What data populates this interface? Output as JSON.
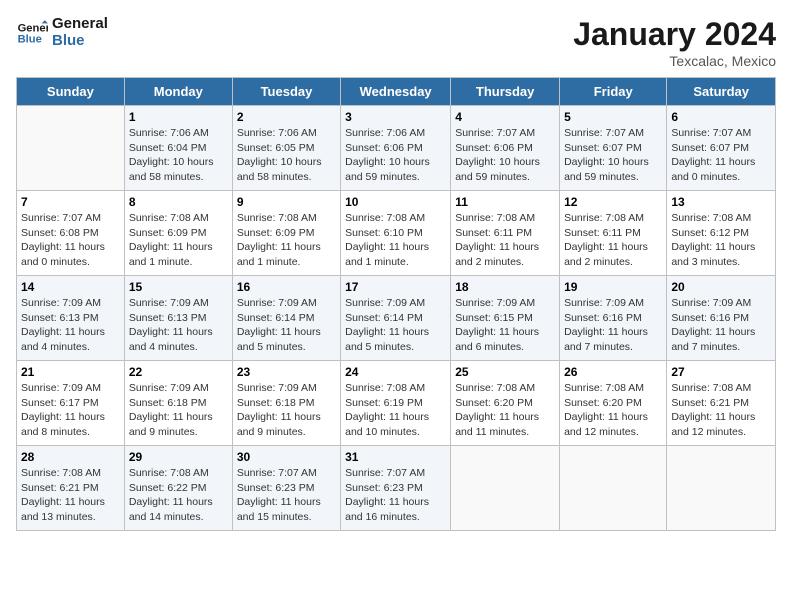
{
  "header": {
    "logo_general": "General",
    "logo_blue": "Blue",
    "title": "January 2024",
    "subtitle": "Texcalac, Mexico"
  },
  "weekdays": [
    "Sunday",
    "Monday",
    "Tuesday",
    "Wednesday",
    "Thursday",
    "Friday",
    "Saturday"
  ],
  "weeks": [
    [
      {
        "num": "",
        "info": ""
      },
      {
        "num": "1",
        "info": "Sunrise: 7:06 AM\nSunset: 6:04 PM\nDaylight: 10 hours\nand 58 minutes."
      },
      {
        "num": "2",
        "info": "Sunrise: 7:06 AM\nSunset: 6:05 PM\nDaylight: 10 hours\nand 58 minutes."
      },
      {
        "num": "3",
        "info": "Sunrise: 7:06 AM\nSunset: 6:06 PM\nDaylight: 10 hours\nand 59 minutes."
      },
      {
        "num": "4",
        "info": "Sunrise: 7:07 AM\nSunset: 6:06 PM\nDaylight: 10 hours\nand 59 minutes."
      },
      {
        "num": "5",
        "info": "Sunrise: 7:07 AM\nSunset: 6:07 PM\nDaylight: 10 hours\nand 59 minutes."
      },
      {
        "num": "6",
        "info": "Sunrise: 7:07 AM\nSunset: 6:07 PM\nDaylight: 11 hours\nand 0 minutes."
      }
    ],
    [
      {
        "num": "7",
        "info": "Sunrise: 7:07 AM\nSunset: 6:08 PM\nDaylight: 11 hours\nand 0 minutes."
      },
      {
        "num": "8",
        "info": "Sunrise: 7:08 AM\nSunset: 6:09 PM\nDaylight: 11 hours\nand 1 minute."
      },
      {
        "num": "9",
        "info": "Sunrise: 7:08 AM\nSunset: 6:09 PM\nDaylight: 11 hours\nand 1 minute."
      },
      {
        "num": "10",
        "info": "Sunrise: 7:08 AM\nSunset: 6:10 PM\nDaylight: 11 hours\nand 1 minute."
      },
      {
        "num": "11",
        "info": "Sunrise: 7:08 AM\nSunset: 6:11 PM\nDaylight: 11 hours\nand 2 minutes."
      },
      {
        "num": "12",
        "info": "Sunrise: 7:08 AM\nSunset: 6:11 PM\nDaylight: 11 hours\nand 2 minutes."
      },
      {
        "num": "13",
        "info": "Sunrise: 7:08 AM\nSunset: 6:12 PM\nDaylight: 11 hours\nand 3 minutes."
      }
    ],
    [
      {
        "num": "14",
        "info": "Sunrise: 7:09 AM\nSunset: 6:13 PM\nDaylight: 11 hours\nand 4 minutes."
      },
      {
        "num": "15",
        "info": "Sunrise: 7:09 AM\nSunset: 6:13 PM\nDaylight: 11 hours\nand 4 minutes."
      },
      {
        "num": "16",
        "info": "Sunrise: 7:09 AM\nSunset: 6:14 PM\nDaylight: 11 hours\nand 5 minutes."
      },
      {
        "num": "17",
        "info": "Sunrise: 7:09 AM\nSunset: 6:14 PM\nDaylight: 11 hours\nand 5 minutes."
      },
      {
        "num": "18",
        "info": "Sunrise: 7:09 AM\nSunset: 6:15 PM\nDaylight: 11 hours\nand 6 minutes."
      },
      {
        "num": "19",
        "info": "Sunrise: 7:09 AM\nSunset: 6:16 PM\nDaylight: 11 hours\nand 7 minutes."
      },
      {
        "num": "20",
        "info": "Sunrise: 7:09 AM\nSunset: 6:16 PM\nDaylight: 11 hours\nand 7 minutes."
      }
    ],
    [
      {
        "num": "21",
        "info": "Sunrise: 7:09 AM\nSunset: 6:17 PM\nDaylight: 11 hours\nand 8 minutes."
      },
      {
        "num": "22",
        "info": "Sunrise: 7:09 AM\nSunset: 6:18 PM\nDaylight: 11 hours\nand 9 minutes."
      },
      {
        "num": "23",
        "info": "Sunrise: 7:09 AM\nSunset: 6:18 PM\nDaylight: 11 hours\nand 9 minutes."
      },
      {
        "num": "24",
        "info": "Sunrise: 7:08 AM\nSunset: 6:19 PM\nDaylight: 11 hours\nand 10 minutes."
      },
      {
        "num": "25",
        "info": "Sunrise: 7:08 AM\nSunset: 6:20 PM\nDaylight: 11 hours\nand 11 minutes."
      },
      {
        "num": "26",
        "info": "Sunrise: 7:08 AM\nSunset: 6:20 PM\nDaylight: 11 hours\nand 12 minutes."
      },
      {
        "num": "27",
        "info": "Sunrise: 7:08 AM\nSunset: 6:21 PM\nDaylight: 11 hours\nand 12 minutes."
      }
    ],
    [
      {
        "num": "28",
        "info": "Sunrise: 7:08 AM\nSunset: 6:21 PM\nDaylight: 11 hours\nand 13 minutes."
      },
      {
        "num": "29",
        "info": "Sunrise: 7:08 AM\nSunset: 6:22 PM\nDaylight: 11 hours\nand 14 minutes."
      },
      {
        "num": "30",
        "info": "Sunrise: 7:07 AM\nSunset: 6:23 PM\nDaylight: 11 hours\nand 15 minutes."
      },
      {
        "num": "31",
        "info": "Sunrise: 7:07 AM\nSunset: 6:23 PM\nDaylight: 11 hours\nand 16 minutes."
      },
      {
        "num": "",
        "info": ""
      },
      {
        "num": "",
        "info": ""
      },
      {
        "num": "",
        "info": ""
      }
    ]
  ]
}
